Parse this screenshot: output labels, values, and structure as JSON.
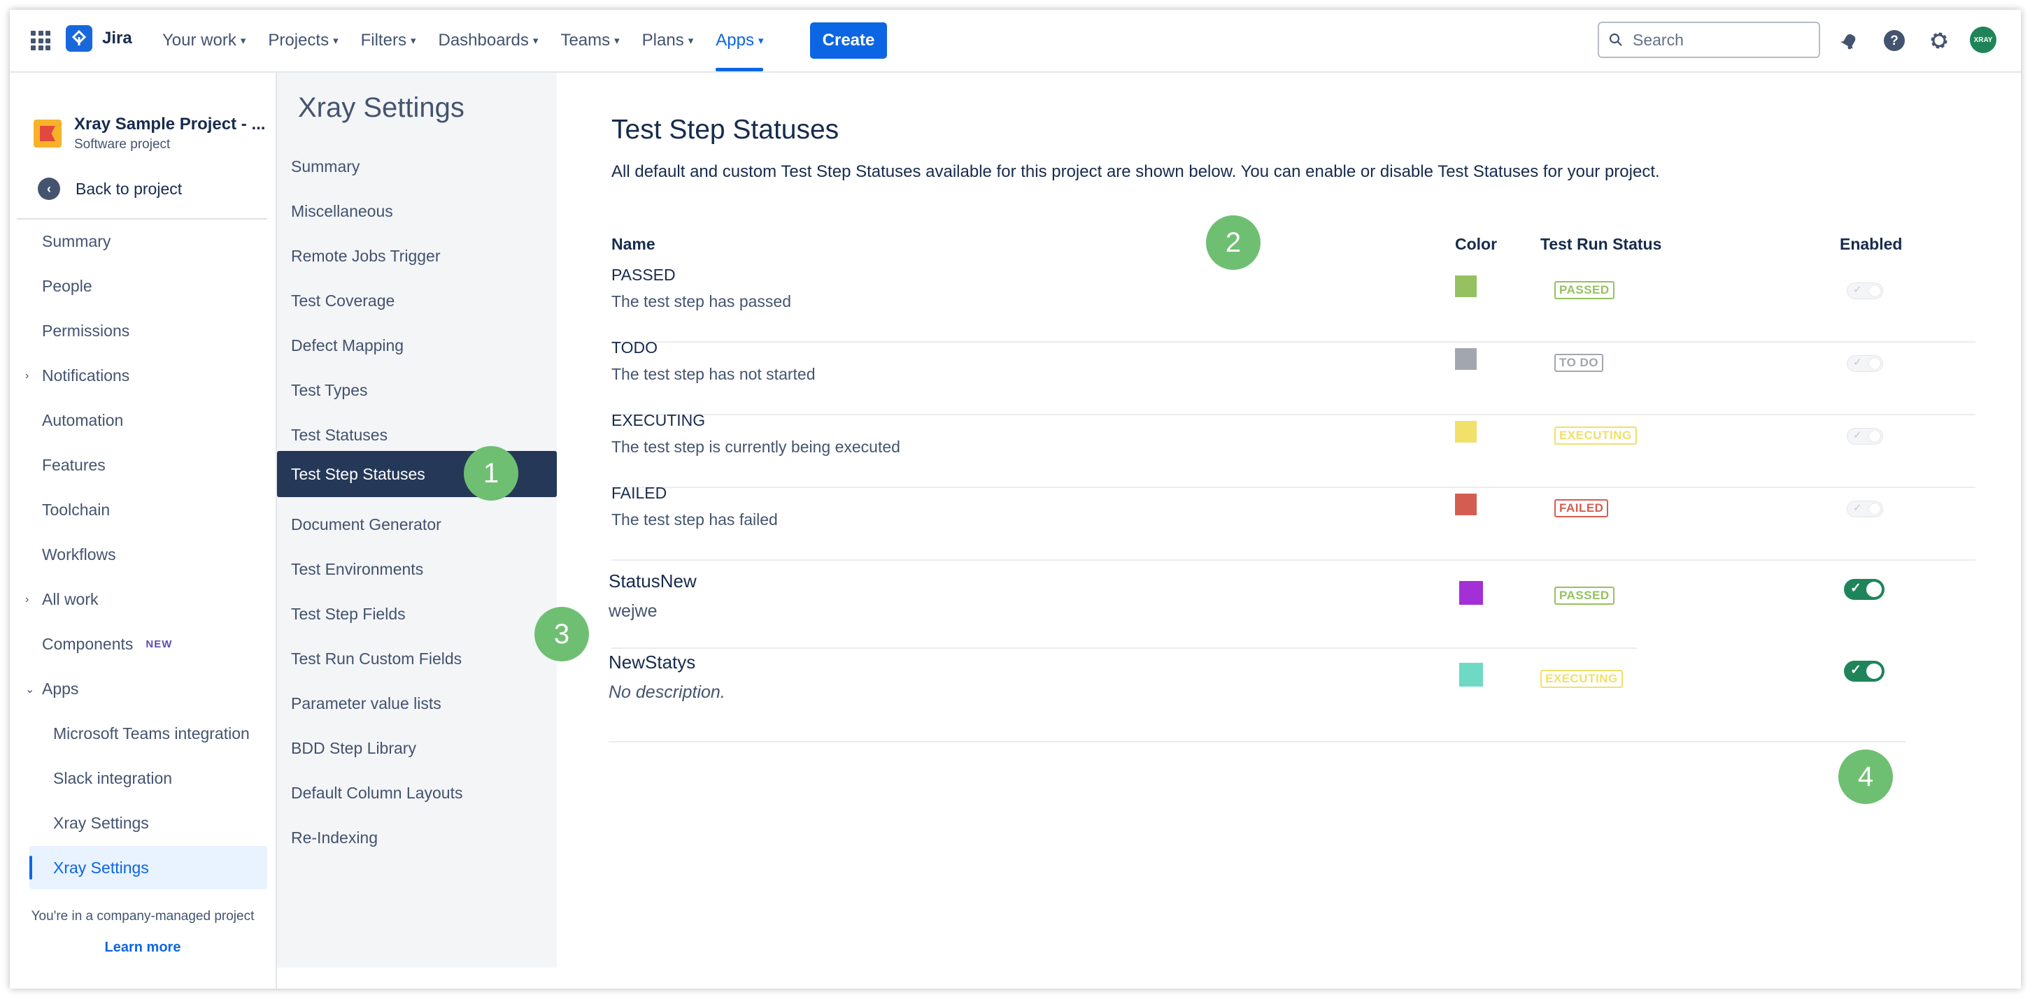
{
  "topbar": {
    "logo_text": "Jira",
    "nav": [
      "Your work",
      "Projects",
      "Filters",
      "Dashboards",
      "Teams",
      "Plans",
      "Apps"
    ],
    "active_nav": "Apps",
    "create_label": "Create",
    "search_placeholder": "Search",
    "avatar_text": "XRAY"
  },
  "sidebar": {
    "project_name": "Xray Sample Project - ...",
    "project_type": "Software project",
    "back_label": "Back to project",
    "items": [
      {
        "label": "Summary"
      },
      {
        "label": "People"
      },
      {
        "label": "Permissions"
      },
      {
        "label": "Notifications"
      },
      {
        "label": "Automation"
      },
      {
        "label": "Features"
      },
      {
        "label": "Toolchain"
      },
      {
        "label": "Workflows"
      },
      {
        "label": "All work"
      },
      {
        "label": "Components",
        "badge": "NEW"
      },
      {
        "label": "Apps"
      }
    ],
    "app_items": [
      {
        "label": "Microsoft Teams integration"
      },
      {
        "label": "Slack integration"
      },
      {
        "label": "Xray Settings"
      },
      {
        "label": "Xray Settings"
      }
    ],
    "company_note": "You're in a company-managed project",
    "learn_more": "Learn more"
  },
  "xray_settings": {
    "title": "Xray Settings",
    "items": [
      "Summary",
      "Miscellaneous",
      "Remote Jobs Trigger",
      "Test Coverage",
      "Defect Mapping",
      "Test Types",
      "Test Statuses",
      "Test Step Statuses",
      "Document Generator",
      "Test Environments",
      "Test Step Fields",
      "Test Run Custom Fields",
      "Parameter value lists",
      "BDD Step Library",
      "Default Column Layouts",
      "Re-Indexing"
    ],
    "active_item": "Test Step Statuses"
  },
  "main": {
    "title": "Test Step Statuses",
    "description": "All default and custom Test Step Statuses available for this project are shown below. You can enable or disable Test Statuses for your project.",
    "columns": {
      "name": "Name",
      "color": "Color",
      "run_status": "Test Run Status",
      "enabled": "Enabled"
    },
    "rows": [
      {
        "name": "PASSED",
        "description": "The test step has passed",
        "color": "#95c160",
        "run_status": "PASSED",
        "run_status_color": "#95c160",
        "enabled": true,
        "editable": false
      },
      {
        "name": "TODO",
        "description": "The test step has not started",
        "color": "#a2a6ae",
        "run_status": "TO DO",
        "run_status_color": "#a2a6ae",
        "enabled": true,
        "editable": false
      },
      {
        "name": "EXECUTING",
        "description": "The test step is currently being executed",
        "color": "#f1e069",
        "run_status": "EXECUTING",
        "run_status_color": "#f1e069",
        "enabled": true,
        "editable": false
      },
      {
        "name": "FAILED",
        "description": "The test step has failed",
        "color": "#d45d52",
        "run_status": "FAILED",
        "run_status_color": "#d45d52",
        "enabled": true,
        "editable": false
      },
      {
        "name": "StatusNew",
        "description": "wejwe",
        "color": "#a32fd6",
        "run_status": "PASSED",
        "run_status_color": "#95c160",
        "enabled": true,
        "editable": true
      },
      {
        "name": "NewStatys",
        "description": "No description.",
        "color": "#6fdac4",
        "run_status": "EXECUTING",
        "run_status_color": "#f1e069",
        "enabled": true,
        "editable": true
      }
    ]
  },
  "markers": [
    "1",
    "2",
    "3",
    "4"
  ]
}
